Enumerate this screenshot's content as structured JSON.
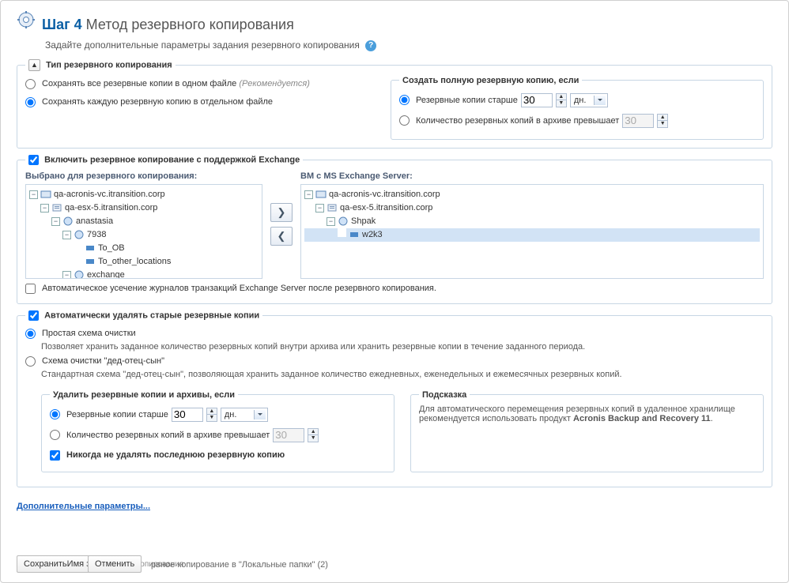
{
  "header": {
    "step_prefix": "Шаг 4",
    "step_title": "Метод резервного копирования",
    "subtitle": "Задайте дополнительные параметры задания резервного копирования"
  },
  "backup_type": {
    "legend": "Тип резервного копирования",
    "opt_single_file": "Сохранять все резервные копии в одном файле",
    "opt_single_file_rec": "(Рекомендуется)",
    "opt_separate_files": "Сохранять каждую резервную копию в отдельном файле",
    "full_copy": {
      "legend": "Создать полную резервную копию, если",
      "older_than": "Резервные копии старше",
      "older_than_value": "30",
      "older_than_unit": "дн.",
      "count_exceeds": "Количество резервных копий в архиве превышает",
      "count_value": "30"
    }
  },
  "exchange": {
    "enable_label": "Включить резервное копирование с поддержкой Exchange",
    "left_header": "Выбрано для резервного копирования:",
    "right_header": "ВМ с MS Exchange Server:",
    "left_tree": {
      "n0": "qa-acronis-vc.itransition.corp",
      "n1": "qa-esx-5.itransition.corp",
      "n2": "anastasia",
      "n3": "7938",
      "n4": "To_OB",
      "n5": "To_other_locations",
      "n6": "exchange"
    },
    "right_tree": {
      "n0": "qa-acronis-vc.itransition.corp",
      "n1": "qa-esx-5.itransition.corp",
      "n2": "Shpak",
      "n3": "w2k3"
    },
    "truncate_logs": "Автоматическое усечение журналов транзакций Exchange Server после резервного копирования."
  },
  "cleanup": {
    "enable_label": "Автоматически удалять старые резервные копии",
    "simple_label": "Простая схема очистки",
    "simple_desc": "Позволяет хранить заданное количество резервных копий внутри архива или хранить резервные копии в течение заданного периода.",
    "gfs_label": "Схема очистки \"дед-отец-сын\"",
    "gfs_desc": "Стандартная схема \"дед-отец-сын\", позволяющая хранить заданное количество ежедневных, еженедельных и ежемесячных резервных копий.",
    "delete_rules": {
      "legend": "Удалить резервные копии и архивы, если",
      "older_than": "Резервные копии старше",
      "older_than_value": "30",
      "older_than_unit": "дн.",
      "count_exceeds": "Количество резервных копий в архиве превышает",
      "count_value": "30",
      "never_delete_last": "Никогда не удалять последнюю резервную копию"
    },
    "hint": {
      "legend": "Подсказка",
      "text_prefix": "Для автоматического перемещения резервных копий в удаленное хранилище рекомендуется использовать продукт",
      "product": "Acronis Backup and Recovery 11"
    }
  },
  "advanced_link": "Дополнительные параметры...",
  "footer": {
    "btn_save": "Сохранить",
    "btn_cancel": "Отменить",
    "overlay_text1": "Имя задания:",
    "overlay_text2": "рвное копирование в \"Локальные папки\" (2)",
    "legend_text": "го копирования"
  }
}
